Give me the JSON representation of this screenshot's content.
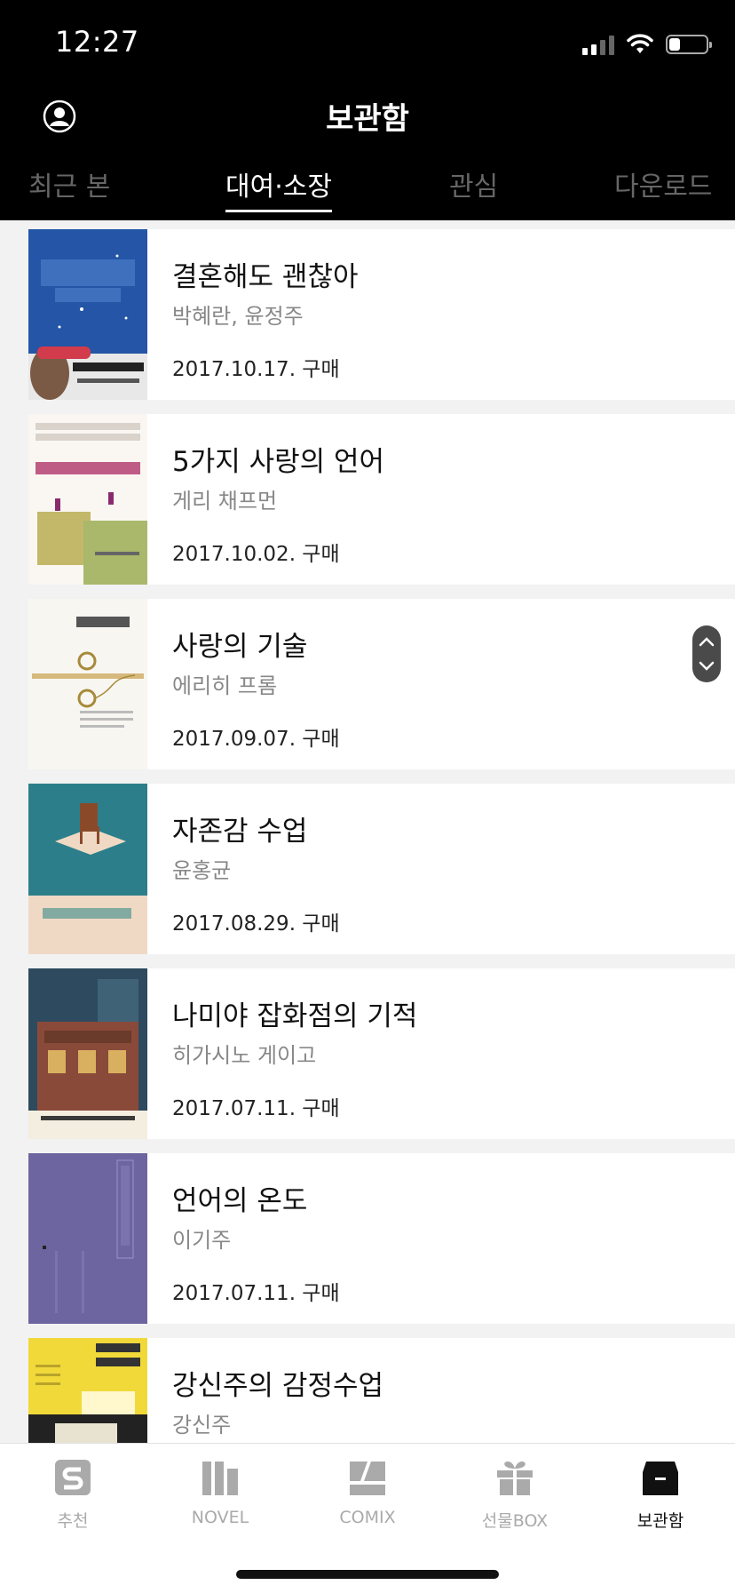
{
  "status_bar": {
    "time": "12:27"
  },
  "header": {
    "title": "보관함",
    "tabs": [
      {
        "label": "최근 본",
        "active": false
      },
      {
        "label": "대여·소장",
        "active": true
      },
      {
        "label": "관심",
        "active": false
      },
      {
        "label": "다운로드",
        "active": false
      }
    ]
  },
  "books": [
    {
      "title": "결혼해도 괜찮아",
      "author": "박혜란, 윤정주",
      "date": "2017.10.17. 구매"
    },
    {
      "title": "5가지 사랑의 언어",
      "author": "게리 채프먼",
      "date": "2017.10.02. 구매"
    },
    {
      "title": "사랑의 기술",
      "author": "에리히 프롬",
      "date": "2017.09.07. 구매"
    },
    {
      "title": "자존감 수업",
      "author": "윤홍균",
      "date": "2017.08.29. 구매"
    },
    {
      "title": "나미야 잡화점의 기적",
      "author": "히가시노 게이고",
      "date": "2017.07.11. 구매"
    },
    {
      "title": "언어의 온도",
      "author": "이기주",
      "date": "2017.07.11. 구매"
    },
    {
      "title": "강신주의 감정수업",
      "author": "강신주",
      "date": ""
    }
  ],
  "bottom_nav": [
    {
      "label": "추천",
      "icon": "s-logo-icon",
      "active": false
    },
    {
      "label": "NOVEL",
      "icon": "books-icon",
      "active": false
    },
    {
      "label": "COMIX",
      "icon": "comix-icon",
      "active": false
    },
    {
      "label": "선물BOX",
      "icon": "gift-icon",
      "active": false
    },
    {
      "label": "보관함",
      "icon": "archive-box-icon",
      "active": true
    }
  ],
  "colors": {
    "header_bg": "#000000",
    "active_text": "#ffffff",
    "inactive_tab": "#666666",
    "nav_inactive": "#aaaaaa"
  }
}
